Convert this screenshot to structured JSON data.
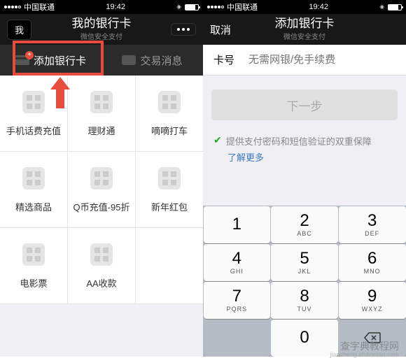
{
  "status": {
    "carrier": "中国联通",
    "time": "19:42"
  },
  "left_screen": {
    "nav_left": "我",
    "title": "我的银行卡",
    "subtitle": "微信安全支付",
    "tab_add": "添加银行卡",
    "tab_msg": "交易消息",
    "grid": [
      [
        "手机话费充值",
        "理财通",
        "嘀嘀打车"
      ],
      [
        "精选商品",
        "Q币充值-95折",
        "新年红包"
      ],
      [
        "电影票",
        "AA收款",
        ""
      ]
    ]
  },
  "right_screen": {
    "nav_left": "取消",
    "title": "添加银行卡",
    "subtitle": "微信安全支付",
    "input_label": "卡号",
    "input_placeholder": "无需网银/免手续费",
    "next_button": "下一步",
    "info_text": "提供支付密码和短信验证的双重保障",
    "learn_more": "了解更多"
  },
  "keypad": {
    "keys": [
      [
        {
          "n": "1",
          "l": ""
        },
        {
          "n": "2",
          "l": "ABC"
        },
        {
          "n": "3",
          "l": "DEF"
        }
      ],
      [
        {
          "n": "4",
          "l": "GHI"
        },
        {
          "n": "5",
          "l": "JKL"
        },
        {
          "n": "6",
          "l": "MNO"
        }
      ],
      [
        {
          "n": "7",
          "l": "PQRS"
        },
        {
          "n": "8",
          "l": "TUV"
        },
        {
          "n": "9",
          "l": "WXYZ"
        }
      ]
    ],
    "zero": "0"
  },
  "watermark": "查字典教程网",
  "watermark_sub": "jiaocheng.chazidian.com"
}
